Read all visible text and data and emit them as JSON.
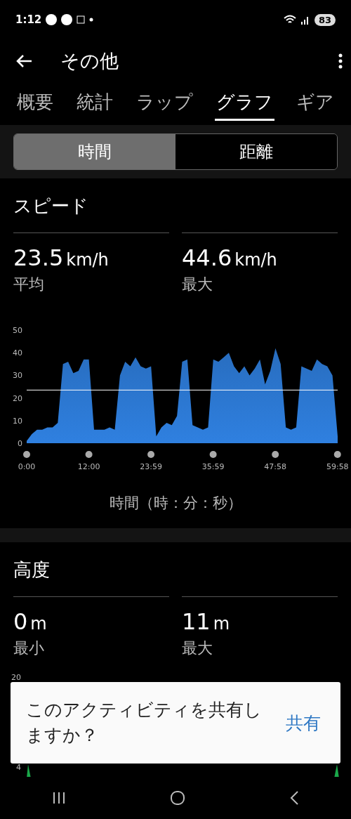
{
  "status_bar": {
    "time": "1:12",
    "battery": "83"
  },
  "header": {
    "title": "その他"
  },
  "tabs": [
    {
      "label": "概要",
      "selected": false
    },
    {
      "label": "統計",
      "selected": false
    },
    {
      "label": "ラップ",
      "selected": false
    },
    {
      "label": "グラフ",
      "selected": true
    },
    {
      "label": "ギア",
      "selected": false
    }
  ],
  "segments": [
    {
      "label": "時間",
      "selected": true
    },
    {
      "label": "距離",
      "selected": false
    }
  ],
  "speed": {
    "title": "スピード",
    "stats": [
      {
        "value": "23.5",
        "unit": "km/h",
        "label": "平均"
      },
      {
        "value": "44.6",
        "unit": "km/h",
        "label": "最大"
      }
    ],
    "chart_data": {
      "type": "area",
      "xlabel": "時間（時：分：秒）",
      "x": [
        0,
        1,
        2,
        3,
        4,
        5,
        6,
        7,
        8,
        9,
        10,
        11,
        12,
        13,
        14,
        15,
        16,
        17,
        18,
        19,
        20,
        21,
        22,
        23,
        24,
        25,
        26,
        27,
        28,
        29,
        30,
        31,
        32,
        33,
        34,
        35,
        36,
        37,
        38,
        39,
        40,
        41,
        42,
        43,
        44,
        45,
        46,
        47,
        48,
        49,
        50,
        51,
        52,
        53,
        54,
        55,
        56,
        57,
        58,
        59,
        60
      ],
      "series": [
        {
          "color": "#2f80e0",
          "values": [
            1,
            4,
            6,
            6,
            7,
            7,
            9,
            35,
            36,
            31,
            32,
            37,
            37,
            6,
            6,
            6,
            7,
            6,
            30,
            36,
            34,
            38,
            34,
            33,
            34,
            3,
            7,
            9,
            8,
            12,
            36,
            37,
            8,
            7,
            6,
            7,
            37,
            36,
            38,
            40,
            34,
            31,
            34,
            30,
            33,
            37,
            26,
            32,
            42,
            35,
            7,
            6,
            7,
            34,
            33,
            32,
            37,
            35,
            34,
            30,
            3
          ]
        }
      ],
      "xlim": [
        0,
        60
      ],
      "ylim": [
        0,
        50
      ],
      "yticks": [
        0,
        10,
        20,
        30,
        40,
        50
      ],
      "xticks": [
        {
          "value": 0,
          "label": "0:00"
        },
        {
          "value": 12,
          "label": "12:00"
        },
        {
          "value": 23.98,
          "label": "23:59"
        },
        {
          "value": 35.98,
          "label": "35:59"
        },
        {
          "value": 47.97,
          "label": "47:58"
        },
        {
          "value": 59.97,
          "label": "59:58"
        }
      ],
      "ref_lines": [
        {
          "axis": "y",
          "value": 23.5
        }
      ]
    }
  },
  "altitude": {
    "title": "高度",
    "stats": [
      {
        "value": "0",
        "unit": "m",
        "label": "最小"
      },
      {
        "value": "11",
        "unit": "m",
        "label": "最大"
      }
    ],
    "axis_labels": [
      "20",
      "4"
    ]
  },
  "toast": {
    "message": "このアクティビティを共有しますか？",
    "action": "共有"
  }
}
